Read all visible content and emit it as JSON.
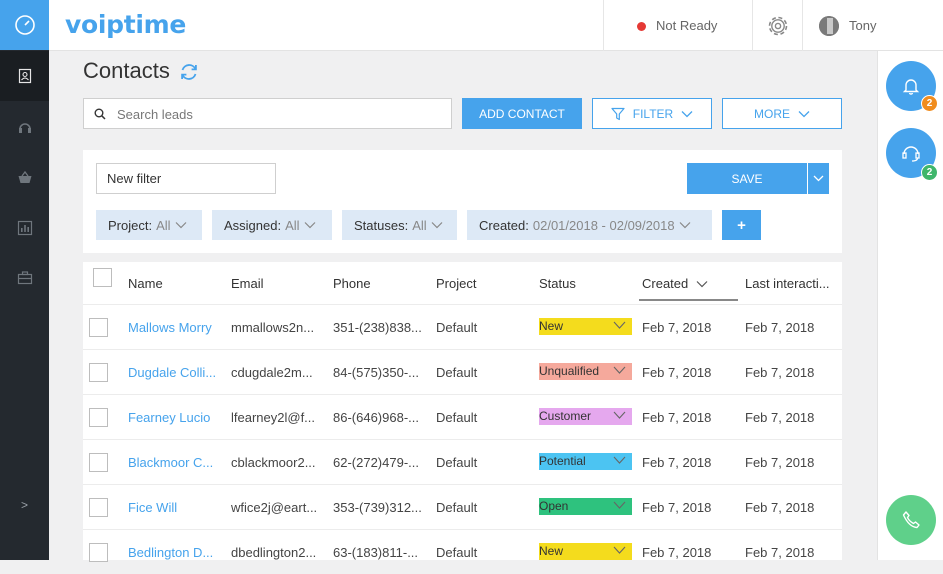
{
  "app": {
    "logo": "voiptime"
  },
  "topbar": {
    "status": "Not Ready",
    "user": "Tony"
  },
  "page": {
    "title": "Contacts"
  },
  "toolbar": {
    "search_placeholder": "Search leads",
    "add_contact": "ADD CONTACT",
    "filter": "FILTER",
    "more": "MORE"
  },
  "filter": {
    "name_value": "New filter",
    "save": "SAVE",
    "add": "+",
    "chips": [
      {
        "label": "Project:",
        "value": "All"
      },
      {
        "label": "Assigned:",
        "value": "All"
      },
      {
        "label": "Statuses:",
        "value": "All"
      },
      {
        "label": "Created:",
        "value": "02/01/2018 - 02/09/2018"
      }
    ]
  },
  "rail": {
    "notifications_count": "2",
    "support_count": "2"
  },
  "sidebar": {
    "expand": ">"
  },
  "table": {
    "columns": [
      "Name",
      "Email",
      "Phone",
      "Project",
      "Status",
      "Created",
      "Last interacti..."
    ],
    "rows": [
      {
        "name": "Mallows Morry",
        "email": "mmallows2n...",
        "phone": "351-(238)838...",
        "project": "Default",
        "status": "New",
        "status_color": "#f4dc1d",
        "created": "Feb 7, 2018",
        "last": "Feb 7, 2018"
      },
      {
        "name": "Dugdale Colli...",
        "email": "cdugdale2m...",
        "phone": "84-(575)350-...",
        "project": "Default",
        "status": "Unqualified",
        "status_color": "#f5a99c",
        "created": "Feb 7, 2018",
        "last": "Feb 7, 2018"
      },
      {
        "name": "Fearney Lucio",
        "email": "lfearney2l@f...",
        "phone": "86-(646)968-...",
        "project": "Default",
        "status": "Customer",
        "status_color": "#e5a8ee",
        "created": "Feb 7, 2018",
        "last": "Feb 7, 2018"
      },
      {
        "name": "Blackmoor C...",
        "email": "cblackmoor2...",
        "phone": "62-(272)479-...",
        "project": "Default",
        "status": "Potential",
        "status_color": "#4cc4f2",
        "created": "Feb 7, 2018",
        "last": "Feb 7, 2018"
      },
      {
        "name": "Fice Will",
        "email": "wfice2j@eart...",
        "phone": "353-(739)312...",
        "project": "Default",
        "status": "Open",
        "status_color": "#2ec27e",
        "created": "Feb 7, 2018",
        "last": "Feb 7, 2018"
      },
      {
        "name": "Bedlington D...",
        "email": "dbedlington2...",
        "phone": "63-(183)811-...",
        "project": "Default",
        "status": "New",
        "status_color": "#f4dc1d",
        "created": "Feb 7, 2018",
        "last": "Feb 7, 2018"
      }
    ]
  }
}
